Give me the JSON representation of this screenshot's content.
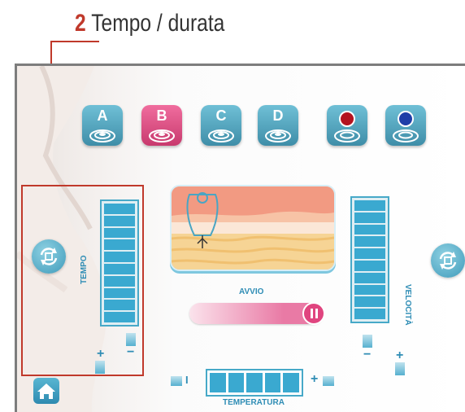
{
  "callout": {
    "number": "2",
    "title": "Tempo / durata",
    "color": "#c0392b"
  },
  "applicators": [
    {
      "label": "A",
      "color": "#4aa5c3",
      "icon": "applicator-pad-icon"
    },
    {
      "label": "B",
      "color": "#e0457f",
      "icon": "applicator-pad-icon",
      "selected": true
    },
    {
      "label": "C",
      "color": "#4aa5c3",
      "icon": "applicator-pad-icon"
    },
    {
      "label": "D",
      "color": "#4aa5c3",
      "icon": "applicator-pad-icon"
    },
    {
      "label": "",
      "color": "#4aa5c3",
      "icon": "red-dot-applicator-icon"
    },
    {
      "label": "",
      "color": "#4aa5c3",
      "icon": "blue-dot-applicator-icon"
    }
  ],
  "tempo": {
    "label": "TEMPO",
    "level": 10,
    "max": 10,
    "plus": "+",
    "minus": "−"
  },
  "velocita": {
    "label": "VELOCITÀ",
    "level": 10,
    "max": 10,
    "plus": "+",
    "minus": "−"
  },
  "avvio": {
    "label": "AVVIO"
  },
  "temperatura": {
    "label": "TEMPERATURA",
    "level": 5,
    "max": 5,
    "minus": "I",
    "plus": "+"
  },
  "icons": {
    "home": "home-icon",
    "cycle": "rotate-cycle-icon",
    "pause": "pause-icon"
  },
  "colors": {
    "accent": "#3aa9d0",
    "pink": "#e0457f",
    "highlight": "#c0392b"
  }
}
